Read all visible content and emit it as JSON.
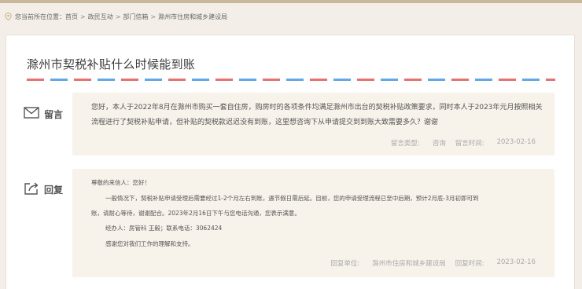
{
  "breadcrumb": {
    "prefix": "您当前所在位置：",
    "items": [
      "首页",
      "政民互动",
      "部门信箱",
      "滁州市住房和城乡建设局"
    ],
    "separator": ">"
  },
  "page_title": "滁州市契税补贴什么时候能到账",
  "message": {
    "label": "留言",
    "icon": "envelope-icon",
    "text": "您好，本人于2022年8月在滁州市购买一套自住房，购房时的各项条件均满足滁州市出台的契税补贴政策要求，同时本人于2023年元月按照相关流程进行了契税补贴申请，但补贴的契税款迟迟没有到账，这里想咨询下从申请提交到到账大致需要多久？谢谢",
    "type_label": "留言类型:",
    "type_value": "咨询",
    "time_label": "留言时间:",
    "time_value": "2023-02-16"
  },
  "reply": {
    "label": "回复",
    "icon": "reply-icon",
    "greeting": "尊敬的来信人：您好！",
    "line1": "一般情况下，契税补贴申请受理后需要经过1-2个月左右到账，遇节假日需后延。目前，您的申请受理流程已至中后期，预计2月底-3月初即可到",
    "line2": "账，请耐心等待，谢谢配合。2023年2月16日下午与您电话沟通，您表示满意。",
    "line3": "经办人：房管科 王毅；联系电话：3062424",
    "line4": "感谢您对我们工作的理解和支持。",
    "unit_label": "回复单位:",
    "unit_value": "滁州市住房和城乡建设局",
    "time_label": "回复时间:",
    "time_value": "2023-02-16"
  },
  "colors": {
    "accent_red": "#e57373",
    "accent_blue": "#64a8e8",
    "box_bg": "#f7f2ea"
  }
}
